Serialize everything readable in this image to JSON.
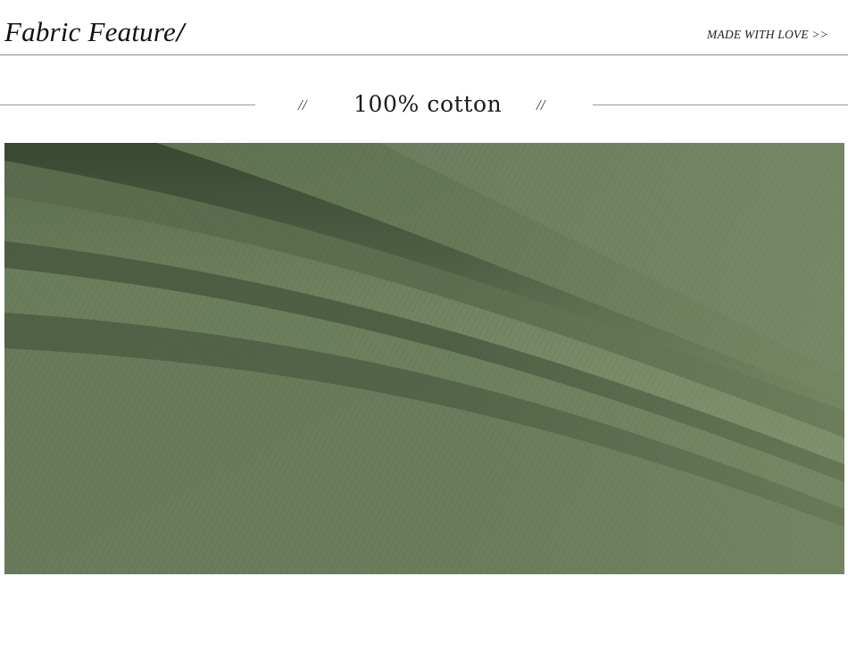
{
  "header": {
    "title": "Fabric Feature",
    "title_slash": "/",
    "tagline": "MADE WITH LOVE >>"
  },
  "section": {
    "left_mark": "//",
    "title": "100% cotton",
    "right_mark": "//"
  },
  "photo": {
    "subject": "olive green cotton fabric folds",
    "color": "#6b7d5b"
  }
}
